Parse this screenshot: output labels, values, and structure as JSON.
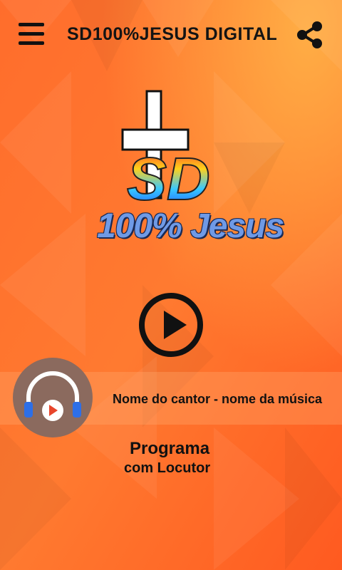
{
  "app": {
    "title": "SD100%JESUS DIGITAL",
    "menu_icon": "hamburger-menu-icon",
    "share_icon": "share-icon"
  },
  "logo": {
    "letters": "SD",
    "text": "100% Jesus"
  },
  "player": {
    "play_icon": "play-icon",
    "track_info": "Nome do cantor - nome da música",
    "artwork_icon": "headphones-play-icon"
  },
  "program": {
    "line1": "Programa",
    "line2": "com Locutor"
  },
  "colors": {
    "background_primary": "#ff6a2a",
    "background_highlight": "#ffb347",
    "foreground": "#111111",
    "logo_blue": "#6f9ae6"
  }
}
